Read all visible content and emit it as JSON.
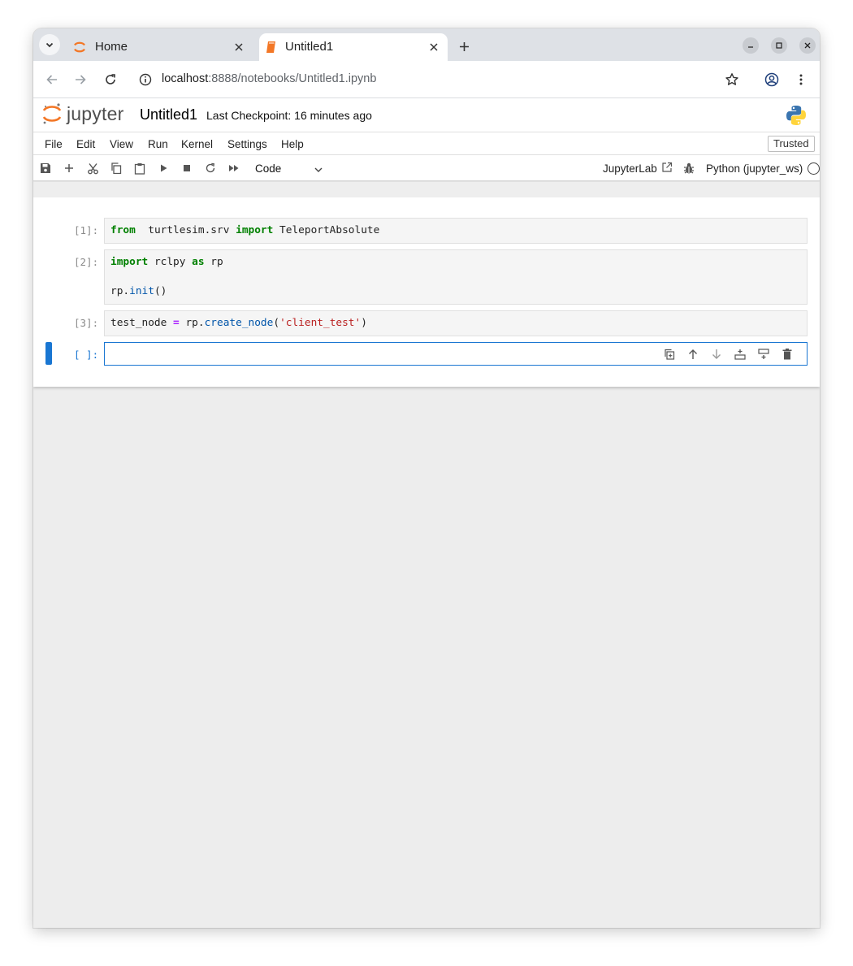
{
  "browser": {
    "tabs": [
      {
        "label": "Home",
        "active": false
      },
      {
        "label": "Untitled1",
        "active": true
      }
    ],
    "url": {
      "host": "localhost",
      "rest": ":8888/notebooks/Untitled1.ipynb"
    }
  },
  "jupyter": {
    "wordmark": "jupyter",
    "notebook_title": "Untitled1",
    "checkpoint": "Last Checkpoint: 16 minutes ago",
    "menu": [
      "File",
      "Edit",
      "View",
      "Run",
      "Kernel",
      "Settings",
      "Help"
    ],
    "trusted": "Trusted",
    "toolbar": {
      "cell_type": "Code",
      "jupyterlab_link": "JupyterLab",
      "kernel": "Python (jupyter_ws)"
    },
    "cells": [
      {
        "prompt": "[1]:",
        "lines": [
          [
            [
              "kw",
              "from"
            ],
            [
              "",
              "  turtlesim.srv "
            ],
            [
              "kw",
              "import"
            ],
            [
              "",
              " TeleportAbsolute"
            ]
          ]
        ]
      },
      {
        "prompt": "[2]:",
        "lines": [
          [
            [
              "kw",
              "import"
            ],
            [
              "",
              " rclpy "
            ],
            [
              "kw",
              "as"
            ],
            [
              "",
              " rp"
            ]
          ],
          [],
          [
            [
              "",
              "rp."
            ],
            [
              "fn",
              "init"
            ],
            [
              "",
              "()"
            ]
          ]
        ]
      },
      {
        "prompt": "[3]:",
        "lines": [
          [
            [
              "",
              "test_node "
            ],
            [
              "op",
              "="
            ],
            [
              "",
              " rp."
            ],
            [
              "fn",
              "create_node"
            ],
            [
              "",
              "("
            ],
            [
              "str",
              "'client_test'"
            ],
            [
              "",
              ")"
            ]
          ]
        ]
      },
      {
        "prompt": "[ ]:",
        "lines": [
          []
        ],
        "active": true
      }
    ]
  },
  "colors": {
    "accent": "#1976d2",
    "jupyter_orange": "#f37726",
    "keyword": "#008000",
    "string": "#ba2121",
    "function": "#0055aa",
    "operator": "#aa22ff"
  }
}
